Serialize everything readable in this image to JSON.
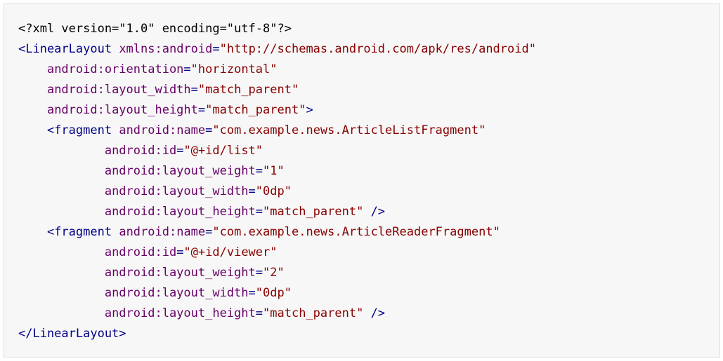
{
  "colors": {
    "background": "#f7f7f7",
    "border": "#dcdcdc",
    "tag": "#000088",
    "attribute": "#660066",
    "string": "#880000",
    "plain": "#000000"
  },
  "code": {
    "lines": [
      [
        {
          "t": "decl",
          "s": "<?xml version=\"1.0\" encoding=\"utf-8\"?>"
        }
      ],
      [
        {
          "t": "tag",
          "s": "<LinearLayout"
        },
        {
          "t": "pln",
          "s": " "
        },
        {
          "t": "attr",
          "s": "xmlns:android"
        },
        {
          "t": "pun",
          "s": "="
        },
        {
          "t": "str",
          "s": "\"http://schemas.android.com/apk/res/android\""
        }
      ],
      [
        {
          "t": "pln",
          "s": "    "
        },
        {
          "t": "attr",
          "s": "android:orientation"
        },
        {
          "t": "pun",
          "s": "="
        },
        {
          "t": "str",
          "s": "\"horizontal\""
        }
      ],
      [
        {
          "t": "pln",
          "s": "    "
        },
        {
          "t": "attr",
          "s": "android:layout_width"
        },
        {
          "t": "pun",
          "s": "="
        },
        {
          "t": "str",
          "s": "\"match_parent\""
        }
      ],
      [
        {
          "t": "pln",
          "s": "    "
        },
        {
          "t": "attr",
          "s": "android:layout_height"
        },
        {
          "t": "pun",
          "s": "="
        },
        {
          "t": "str",
          "s": "\"match_parent\""
        },
        {
          "t": "tag",
          "s": ">"
        }
      ],
      [
        {
          "t": "pln",
          "s": "    "
        },
        {
          "t": "tag",
          "s": "<fragment"
        },
        {
          "t": "pln",
          "s": " "
        },
        {
          "t": "attr",
          "s": "android:name"
        },
        {
          "t": "pun",
          "s": "="
        },
        {
          "t": "str",
          "s": "\"com.example.news.ArticleListFragment\""
        }
      ],
      [
        {
          "t": "pln",
          "s": "            "
        },
        {
          "t": "attr",
          "s": "android:id"
        },
        {
          "t": "pun",
          "s": "="
        },
        {
          "t": "str",
          "s": "\"@+id/list\""
        }
      ],
      [
        {
          "t": "pln",
          "s": "            "
        },
        {
          "t": "attr",
          "s": "android:layout_weight"
        },
        {
          "t": "pun",
          "s": "="
        },
        {
          "t": "str",
          "s": "\"1\""
        }
      ],
      [
        {
          "t": "pln",
          "s": "            "
        },
        {
          "t": "attr",
          "s": "android:layout_width"
        },
        {
          "t": "pun",
          "s": "="
        },
        {
          "t": "str",
          "s": "\"0dp\""
        }
      ],
      [
        {
          "t": "pln",
          "s": "            "
        },
        {
          "t": "attr",
          "s": "android:layout_height"
        },
        {
          "t": "pun",
          "s": "="
        },
        {
          "t": "str",
          "s": "\"match_parent\""
        },
        {
          "t": "pln",
          "s": " "
        },
        {
          "t": "tag",
          "s": "/>"
        }
      ],
      [
        {
          "t": "pln",
          "s": "    "
        },
        {
          "t": "tag",
          "s": "<fragment"
        },
        {
          "t": "pln",
          "s": " "
        },
        {
          "t": "attr",
          "s": "android:name"
        },
        {
          "t": "pun",
          "s": "="
        },
        {
          "t": "str",
          "s": "\"com.example.news.ArticleReaderFragment\""
        }
      ],
      [
        {
          "t": "pln",
          "s": "            "
        },
        {
          "t": "attr",
          "s": "android:id"
        },
        {
          "t": "pun",
          "s": "="
        },
        {
          "t": "str",
          "s": "\"@+id/viewer\""
        }
      ],
      [
        {
          "t": "pln",
          "s": "            "
        },
        {
          "t": "attr",
          "s": "android:layout_weight"
        },
        {
          "t": "pun",
          "s": "="
        },
        {
          "t": "str",
          "s": "\"2\""
        }
      ],
      [
        {
          "t": "pln",
          "s": "            "
        },
        {
          "t": "attr",
          "s": "android:layout_width"
        },
        {
          "t": "pun",
          "s": "="
        },
        {
          "t": "str",
          "s": "\"0dp\""
        }
      ],
      [
        {
          "t": "pln",
          "s": "            "
        },
        {
          "t": "attr",
          "s": "android:layout_height"
        },
        {
          "t": "pun",
          "s": "="
        },
        {
          "t": "str",
          "s": "\"match_parent\""
        },
        {
          "t": "pln",
          "s": " "
        },
        {
          "t": "tag",
          "s": "/>"
        }
      ],
      [
        {
          "t": "tag",
          "s": "</LinearLayout>"
        }
      ]
    ]
  }
}
